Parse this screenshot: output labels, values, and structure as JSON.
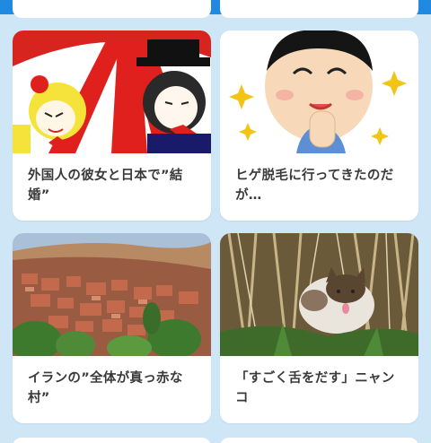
{
  "articles": [
    {
      "title": "外国人の彼女と日本で”結婚”",
      "thumb_icon": "anime-characters-image"
    },
    {
      "title": "ヒゲ脱毛に行ってきたのだが…",
      "thumb_icon": "smiling-man-illustration"
    },
    {
      "title": "イランの”全体が真っ赤な村”",
      "thumb_icon": "red-village-photo"
    },
    {
      "title": "「すごく舌をだす」ニャンコ",
      "thumb_icon": "cat-in-grass-photo"
    }
  ],
  "colors": {
    "background": "#cfe6f7",
    "header": "#1f8ae0",
    "card": "#ffffff",
    "text": "#3a3a3a"
  }
}
